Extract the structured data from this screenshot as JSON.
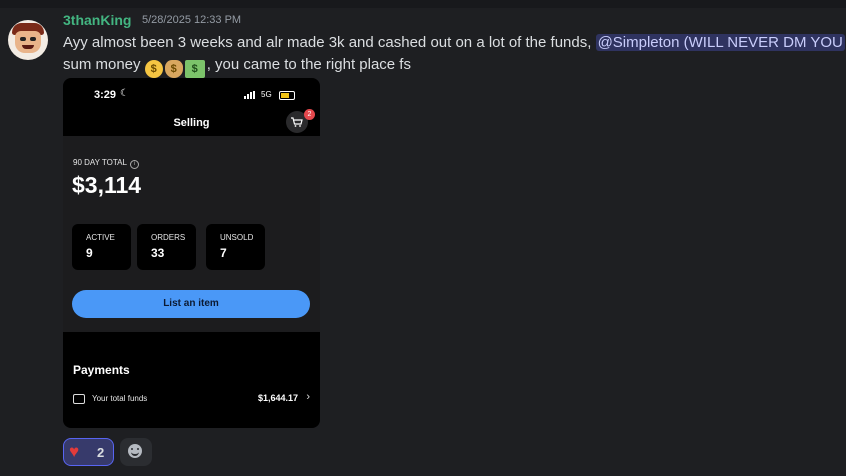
{
  "message": {
    "author": "3thanKing",
    "timestamp": "5/28/2025 12:33 PM",
    "text_line1": "Ayy almost been 3 weeks and alr made 3k and cashed out on a lot of the funds, ",
    "mention": "@Simpleton (WILL NEVER DM YOU",
    "text_line2_start": "sum money ",
    "text_line2_end": ", you came to the right place fs",
    "emojis": [
      "money-mouth-face",
      "money-bag",
      "dollar-banknote"
    ]
  },
  "screenshot": {
    "status_time": "3:29",
    "status_network": "5G",
    "nav_title": "Selling",
    "cart_badge": "2",
    "total_label": "90 DAY TOTAL",
    "total_value": "$3,114",
    "stats": {
      "active": {
        "label": "ACTIVE",
        "value": "9"
      },
      "orders": {
        "label": "ORDERS",
        "value": "33"
      },
      "unsold": {
        "label": "UNSOLD",
        "value": "7"
      }
    },
    "list_button": "List an item",
    "payments_title": "Payments",
    "funds_label": "Your total funds",
    "funds_value": "$1,644.17"
  },
  "reactions": [
    {
      "emoji": "red-heart",
      "count": "2"
    }
  ],
  "colors": {
    "background": "#1e1f22",
    "username": "#43b581",
    "mention_bg": "#3c4270",
    "button_blue": "#4a98f7",
    "reaction_border": "#5865f2"
  }
}
